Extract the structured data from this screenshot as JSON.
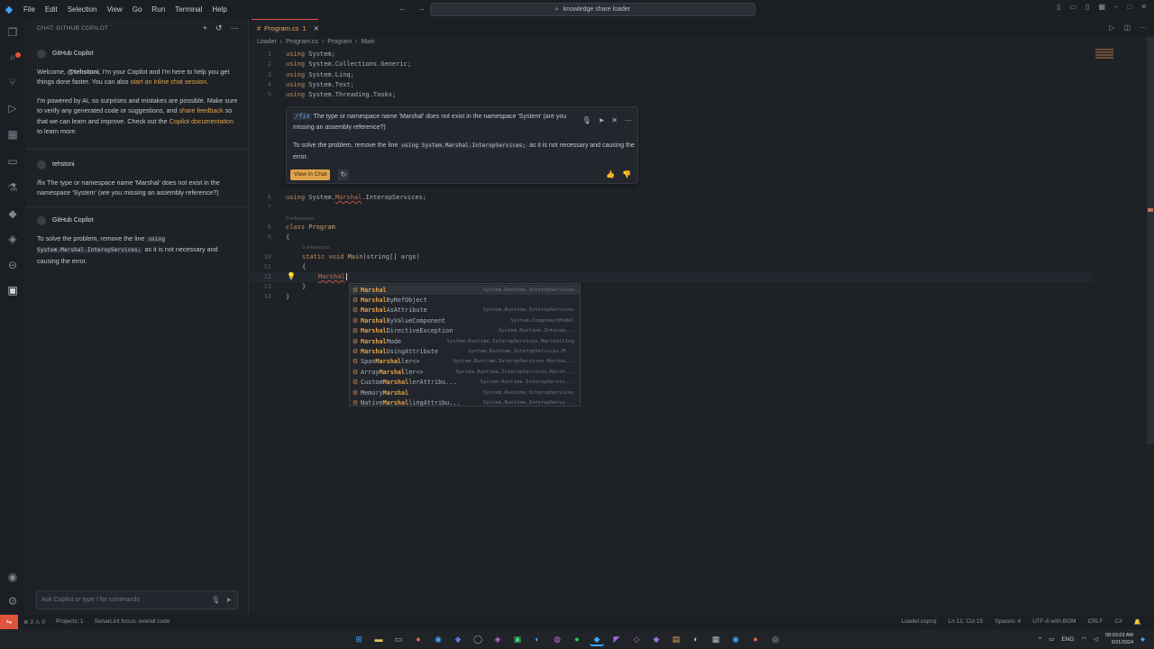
{
  "window": {
    "search": "knowledge share loader"
  },
  "menu": [
    "File",
    "Edit",
    "Selection",
    "View",
    "Go",
    "Run",
    "Terminal",
    "Help"
  ],
  "chat": {
    "header": "CHAT: GITHUB COPILOT",
    "copilot_name": "GitHub Copilot",
    "welcome_pre": "Welcome, ",
    "welcome_user": "@tehstoni",
    "welcome_post": ", I'm your Copilot and I'm here to help you get things done faster. You can also ",
    "welcome_link": "start an inline chat session",
    "welcome_end": ".",
    "powered_pre": "I'm powered by AI, so surprises and mistakes are possible. Make sure to verify any generated code or suggestions, and ",
    "powered_link1": "share feedback",
    "powered_mid": " so that we can learn and improve. Check out the ",
    "powered_link2": "Copilot documentation",
    "powered_end": " to learn more.",
    "user_name": "tehstoni",
    "user_msg": "/fix The type or namespace name 'Marshal' does not exist in the namespace 'System' (are you missing an assembly reference?)",
    "reply_name": "GitHub Copilot",
    "reply_pre": "To solve the problem, remove the line ",
    "reply_code": "using System.Marshal.InteropServices;",
    "reply_post": " as it is not necessary and causing the error.",
    "input_placeholder": "Ask Copilot or type / for commands"
  },
  "editor": {
    "tab_label": "Program.cs",
    "tab_count": "1",
    "breadcrumbs": [
      "Loader",
      "Program.cs",
      "Program",
      "Main"
    ],
    "line_numbers": [
      "1",
      "2",
      "3",
      "4",
      "5",
      "6",
      "7",
      "8",
      "9",
      "10",
      "11",
      "12",
      "13",
      "14"
    ],
    "code": {
      "l1_kw": "using",
      "l1_rest": " System;",
      "l2_kw": "using",
      "l2_rest": " System.Collections.Generic;",
      "l3_kw": "using",
      "l3_rest": " System.Linq;",
      "l4_kw": "using",
      "l4_rest": " System.Text;",
      "l5_kw": "using",
      "l5_rest": " System.Threading.Tasks;",
      "l6_kw": "using",
      "l6_a": " System.",
      "l6_err": "Marshal",
      "l6_b": ".InteropServices;",
      "refs": "0 references",
      "l8_kw": "class",
      "l8_name": " Program",
      "l9": "{",
      "l10_kw": "static void",
      "l10_name": " Main",
      "l10_args": "(string[] args)",
      "l11": "{",
      "l12": "Marshal",
      "l13": "}",
      "l14": "}"
    }
  },
  "inline_chat": {
    "fix_cmd": "/fix",
    "question": " The type or namespace name 'Marshal' does not exist in the namespace 'System' (are you missing an assembly reference?)",
    "answer_pre": "To solve the problem, remove the line ",
    "answer_code": "using System.Marshal.InteropServices;",
    "answer_post": " as it is not necessary and causing the error.",
    "view_in_chat": "View in Chat"
  },
  "suggestions": [
    {
      "match": "Marshal",
      "rest": "",
      "detail": "System.Runtime.InteropServices"
    },
    {
      "match": "Marshal",
      "rest": "ByRefObject",
      "detail": ""
    },
    {
      "match": "Marshal",
      "rest": "AsAttribute",
      "detail": "System.Runtime.InteropServices"
    },
    {
      "match": "Marshal",
      "rest": "ByValueComponent",
      "detail": "System.ComponentModel"
    },
    {
      "match": "Marshal",
      "rest": "DirectiveException",
      "detail": "System.Runtime.Interop..."
    },
    {
      "match": "Marshal",
      "rest": "Mode",
      "detail": "System.Runtime.InteropServices.Marshalling"
    },
    {
      "match": "Marshal",
      "rest": "UsingAttribute",
      "detail": "System.Runtime.InteropServices.M..."
    },
    {
      "pre": "Span",
      "match": "Marshal",
      "rest": "ler<>",
      "detail": "System.Runtime.InteropServices.Marsha..."
    },
    {
      "pre": "Array",
      "match": "Marshal",
      "rest": "ler<>",
      "detail": "System.Runtime.InteropServices.Marsh..."
    },
    {
      "pre": "Custom",
      "match": "Marshal",
      "rest": "lerAttribu...",
      "detail": "System.Runtime.InteropServic..."
    },
    {
      "pre": "Memory",
      "match": "Marshal",
      "rest": "",
      "detail": "System.Runtime.InteropServices"
    },
    {
      "pre": "Native",
      "match": "Marshal",
      "rest": "lingAttribu...",
      "detail": "System.Runtime.InteropServi..."
    }
  ],
  "status": {
    "problems_err": "3",
    "problems_warn": "0",
    "projects": "Projects: 1",
    "sonarlint": "SonarLint focus: overall code",
    "project_file": "Loader.csproj",
    "position": "Ln 12, Col 15",
    "spaces": "Spaces: 4",
    "encoding": "UTF-8 with BOM",
    "eol": "CRLF",
    "language": "C#"
  },
  "taskbar": {
    "lang": "ENG",
    "time": "08:03:03 AM",
    "date": "3/21/2024"
  }
}
